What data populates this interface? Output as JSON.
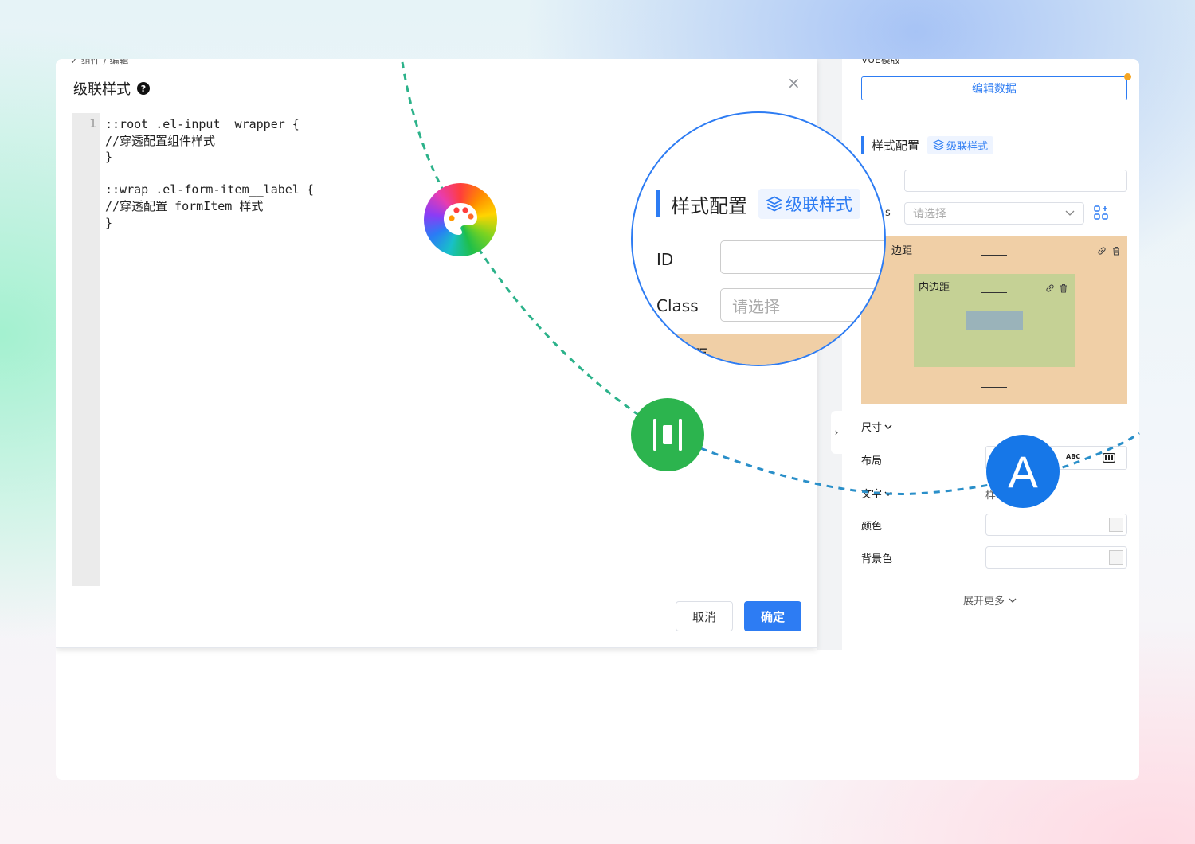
{
  "breadcrumb": "✓ 组件 / 编辑",
  "dialog": {
    "title": "级联样式",
    "help_icon": "?",
    "close_icon": "×",
    "line_number": "1",
    "code_lines": [
      "::root .el-input__wrapper {",
      "//穿透配置组件样式",
      "}",
      "",
      "::wrap .el-form-item__label {",
      "//穿透配置 formItem 样式",
      "}"
    ],
    "cancel_label": "取消",
    "ok_label": "确定"
  },
  "panel": {
    "top_label": "VUE模版",
    "edit_data_label": "编辑数据",
    "section_title": "样式配置",
    "cascade_tag": "级联样式",
    "class_label_fragment": "s",
    "class_placeholder": "请选择",
    "margin_label": "边距",
    "padding_label": "内边距",
    "size_label": "尺寸",
    "layout_label": "布局",
    "text_label": "文字",
    "text_value_fragment": "样",
    "abc_label": "ABC",
    "color_label": "颜色",
    "bg_color_label": "背景色",
    "expand_more": "展开更多",
    "collapse_handle": "›"
  },
  "magnifier": {
    "section_title": "样式配置",
    "cascade_tag": "级联样式",
    "id_label": "ID",
    "class_label": "Class",
    "class_placeholder": "请选择",
    "margin_fragment": "距"
  },
  "badge_a": "A",
  "colors": {
    "primary": "#2d7cf3",
    "green": "#2cb44e",
    "blue_badge": "#1677e8",
    "margin_box": "#f0cfa6",
    "padding_box": "#c5d195",
    "content_box": "#9ab3ba"
  }
}
